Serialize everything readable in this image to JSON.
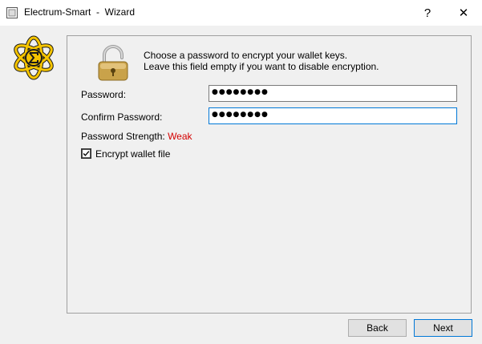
{
  "window": {
    "title": "Electrum-Smart  -  Wizard",
    "help_symbol": "?",
    "close_symbol": "✕"
  },
  "message": {
    "line1": "Choose a password to encrypt your wallet keys.",
    "line2": "Leave this field empty if you want to disable encryption."
  },
  "form": {
    "password_label": "Password:",
    "password_value": "●●●●●●●●",
    "confirm_label": "Confirm Password:",
    "confirm_value": "●●●●●●●●",
    "strength_label": "Password Strength: ",
    "strength_value": "Weak",
    "encrypt_label": "Encrypt wallet file",
    "encrypt_checked": true
  },
  "buttons": {
    "back": "Back",
    "next": "Next"
  },
  "colors": {
    "strength_weak": "#d40000",
    "focus_border": "#0078d7",
    "logo_yellow": "#f5c400"
  },
  "icons": {
    "app": "electrum-smart-icon",
    "logo": "electrum-smart-logo",
    "padlock": "padlock-icon",
    "checkmark": "checkmark-icon"
  }
}
